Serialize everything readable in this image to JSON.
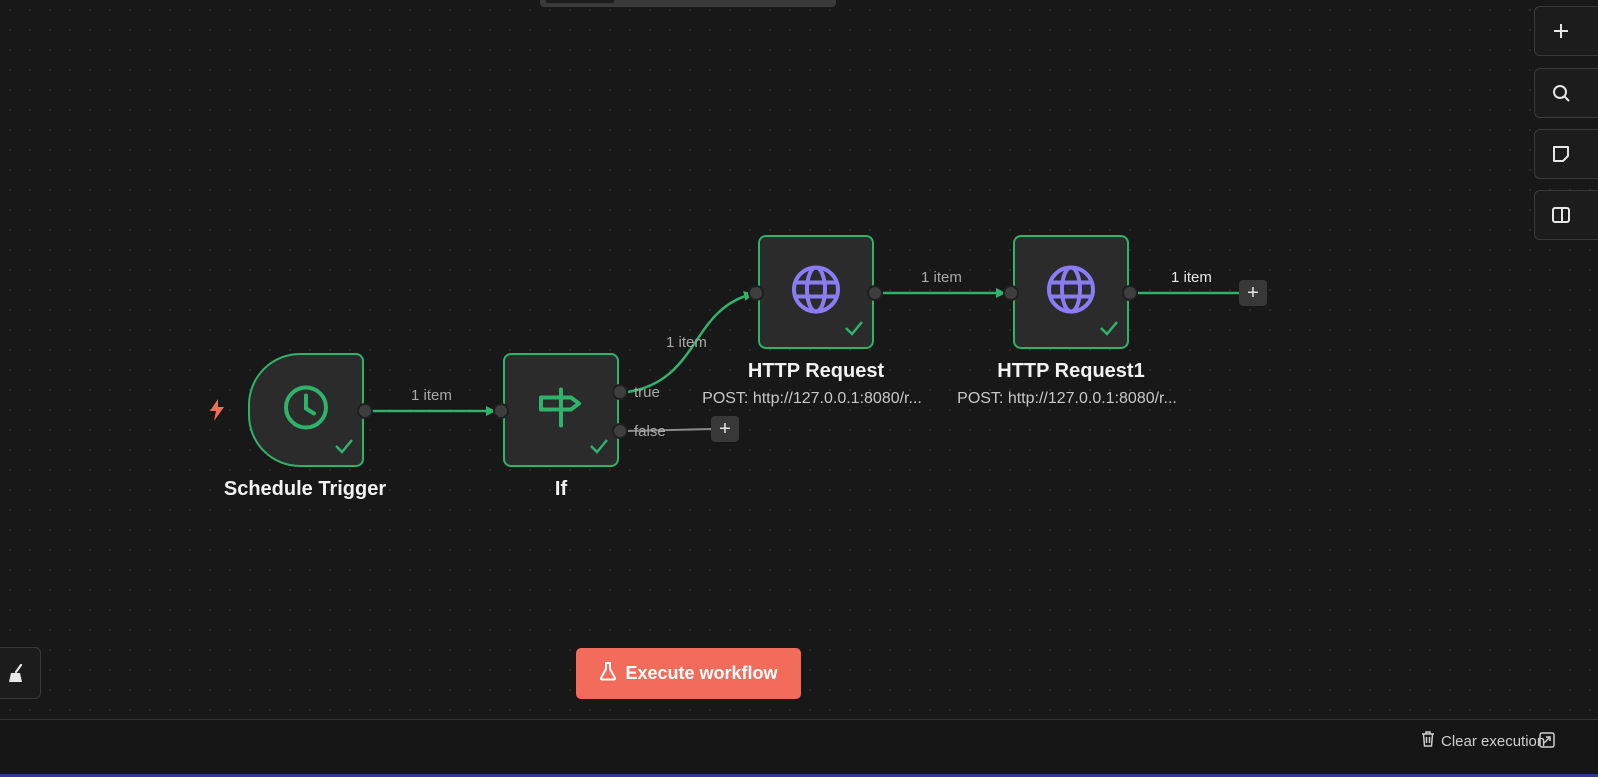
{
  "colors": {
    "canvas_bg": "#181818",
    "node_border_success": "#2fb26a",
    "edge_success": "#2fb26a",
    "icon_trigger": "#2fb26a",
    "icon_http": "#8b7cf6",
    "trigger_bolt": "#f26b5b",
    "execute_button": "#f26b5b"
  },
  "nodes": [
    {
      "id": "schedule-trigger",
      "title": "Schedule Trigger",
      "subtitle": "",
      "icon": "clock-icon",
      "status": "success"
    },
    {
      "id": "if",
      "title": "If",
      "subtitle": "",
      "icon": "signpost-icon",
      "status": "success",
      "outputs": [
        {
          "label": "true"
        },
        {
          "label": "false"
        }
      ]
    },
    {
      "id": "http-request",
      "title": "HTTP Request",
      "subtitle": "POST: http://127.0.0.1:8080/r...",
      "icon": "globe-icon",
      "status": "success"
    },
    {
      "id": "http-request1",
      "title": "HTTP Request1",
      "subtitle": "POST: http://127.0.0.1:8080/r...",
      "icon": "globe-icon",
      "status": "success"
    }
  ],
  "edges": [
    {
      "from": "Schedule Trigger",
      "to": "If",
      "label": "1 item"
    },
    {
      "from": "If (true)",
      "to": "HTTP Request",
      "label": "1 item"
    },
    {
      "from": "HTTP Request",
      "to": "HTTP Request1",
      "label": "1 item"
    },
    {
      "from": "HTTP Request1",
      "to": "",
      "label": "1 item"
    }
  ],
  "add_node_symbol": "+",
  "side_toolbar": [
    {
      "name": "add-node",
      "icon": "plus-icon"
    },
    {
      "name": "search",
      "icon": "search-icon"
    },
    {
      "name": "sticky-note",
      "icon": "sticky-note-icon"
    },
    {
      "name": "toggle-panel",
      "icon": "panel-icon"
    }
  ],
  "execute_button": {
    "label": "Execute workflow",
    "icon": "flask-icon"
  },
  "bottom_bar": {
    "clear_execution_label": "Clear execution",
    "clear_icon": "trash-icon",
    "popout_icon": "popout-icon"
  },
  "tidy_up_icon": "broom-icon"
}
